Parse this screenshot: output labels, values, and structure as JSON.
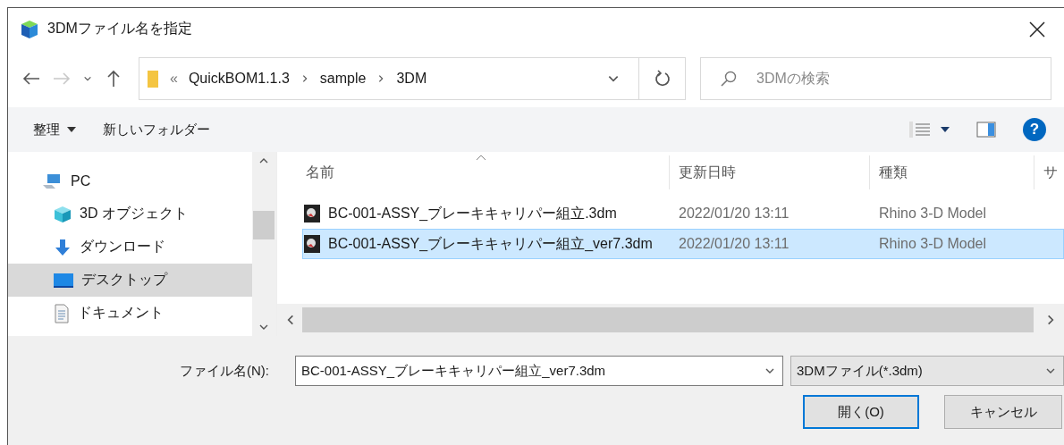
{
  "window": {
    "title": "3DMファイル名を指定"
  },
  "navigation": {
    "back": {
      "disabled": false
    },
    "forward": {
      "disabled": true
    },
    "up": {
      "disabled": false
    }
  },
  "address_bar": {
    "overflow": "«",
    "path": [
      "QuickBOM1.1.3",
      "sample",
      "3DM"
    ]
  },
  "search": {
    "placeholder": "3DMの検索"
  },
  "toolbar": {
    "organize": "整理",
    "new_folder": "新しいフォルダー",
    "help": "?"
  },
  "nav_pane": {
    "items": [
      {
        "label": "PC",
        "kind": "pc",
        "selected": false
      },
      {
        "label": "3D オブジェクト",
        "kind": "objects",
        "selected": false
      },
      {
        "label": "ダウンロード",
        "kind": "downloads",
        "selected": false
      },
      {
        "label": "デスクトップ",
        "kind": "desktop",
        "selected": true
      },
      {
        "label": "ドキュメント",
        "kind": "documents",
        "selected": false
      }
    ]
  },
  "file_list": {
    "columns": [
      "名前",
      "更新日時",
      "種類",
      "サ"
    ],
    "rows": [
      {
        "name": "BC-001-ASSY_ブレーキキャリパー組立.3dm",
        "modified": "2022/01/20 13:11",
        "type": "Rhino 3-D Model",
        "selected": false
      },
      {
        "name": "BC-001-ASSY_ブレーキキャリパー組立_ver7.3dm",
        "modified": "2022/01/20 13:11",
        "type": "Rhino 3-D Model",
        "selected": true
      }
    ]
  },
  "footer": {
    "filename_label": "ファイル名(N):",
    "filename_value": "BC-001-ASSY_ブレーキキャリパー組立_ver7.3dm",
    "filetype": "3DMファイル(*.3dm)",
    "buttons": [
      {
        "label": "開く(O)",
        "kind": "primary"
      },
      {
        "label": "キャンセル",
        "kind": "normal"
      }
    ]
  }
}
